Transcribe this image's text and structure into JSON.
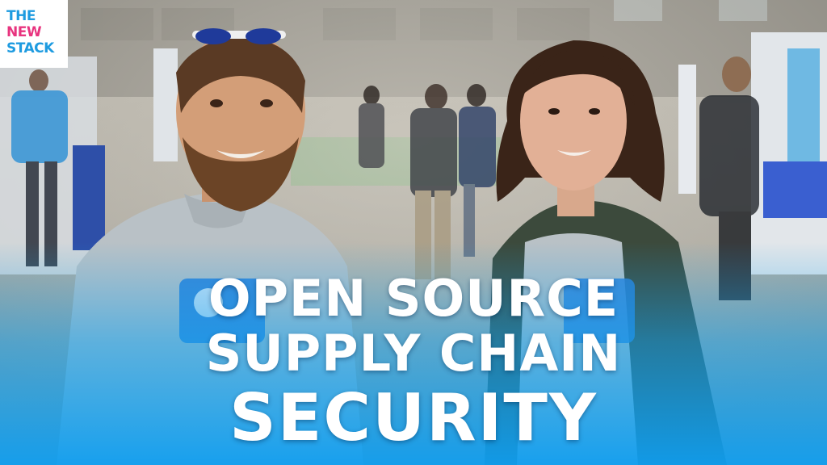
{
  "logo": {
    "line1": "THE",
    "line2": "NEW",
    "line3": "STACK"
  },
  "headline": {
    "line1": "OPEN SOURCE",
    "line2": "SUPPLY CHAIN",
    "line3": "SECURITY"
  },
  "colors": {
    "gradient_blue": "#12a3f0",
    "logo_blue": "#1e9be0",
    "logo_pink": "#e8347f",
    "jacket_green": "#3c4a3c",
    "shirt_grey": "#b9c1c6"
  }
}
